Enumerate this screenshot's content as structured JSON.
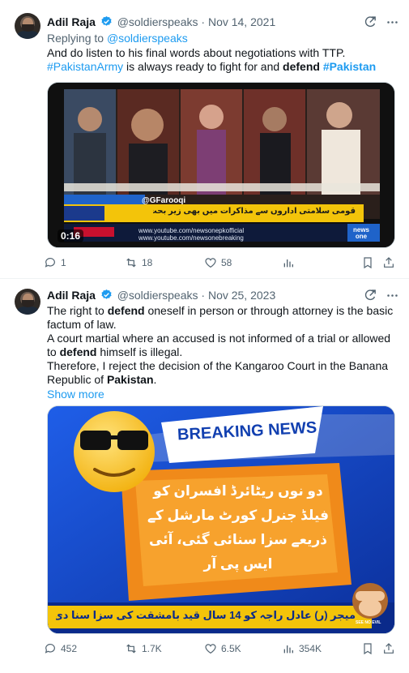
{
  "tweets": [
    {
      "author_name": "Adil Raja",
      "handle": "@soldierspeaks",
      "separator": "·",
      "date": "Nov 14, 2021",
      "replying_prefix": "Replying to ",
      "replying_handle": "@soldierspeaks",
      "line1": "And do listen to his final words about negotiations with TTP.",
      "hashtag1": "#PakistanArmy",
      "line2_mid": " is always ready to fight for and ",
      "bold_word": "defend",
      "hashtag2": "#Pakistan",
      "video": {
        "duration": "0:16",
        "ticker_handle": "@GFarooqi",
        "ticker_url1": "www.youtube.com/newsonepkofficial",
        "ticker_url2": "www.youtube.com/newsonebreaking",
        "channel_logo": "news one",
        "urdu_ticker": "قومی سلامتی اداروں سے مذاکرات میں بھی زیر بحث"
      },
      "stats": {
        "replies": "1",
        "reposts": "18",
        "likes": "58",
        "views": ""
      }
    },
    {
      "author_name": "Adil Raja",
      "handle": "@soldierspeaks",
      "separator": "·",
      "date": "Nov 25, 2023",
      "p1a": "The right to ",
      "p1b": "defend",
      "p1c": " oneself in person or through attorney is the basic factum of law.",
      "p2a": "A court martial where an accused is not informed of a trial or allowed to ",
      "p2b": "defend",
      "p2c": " himself is illegal.",
      "p3a": "Therefore, I reject the decision of the Kangaroo Court in the Banana Republic of ",
      "p3b": "Pakistan",
      "p3c": ".",
      "show_more": "Show more",
      "image": {
        "banner": "BREAKING NEWS",
        "urdu_line1": "دو نوں ریٹائرڈ افسران کو",
        "urdu_line2": "فیلڈ جنرل کورٹ مارشل کے",
        "urdu_line3": "ذریعے سزا سنائی گئی، آئی ایس پی آر",
        "urdu_ticker": "میجر (ر) عادل راجہ کو 14 سال قید بامشقت کی سزا سنا دی گئی، آئی ایس پی آر",
        "monkey_caption": "SEE NO EVIL"
      },
      "stats": {
        "replies": "452",
        "reposts": "1.7K",
        "likes": "6.5K",
        "views": "354K"
      }
    }
  ],
  "icons": {
    "verified_color": "#1d9bf0",
    "link_color": "#1d9bf0",
    "muted_color": "#536471"
  }
}
